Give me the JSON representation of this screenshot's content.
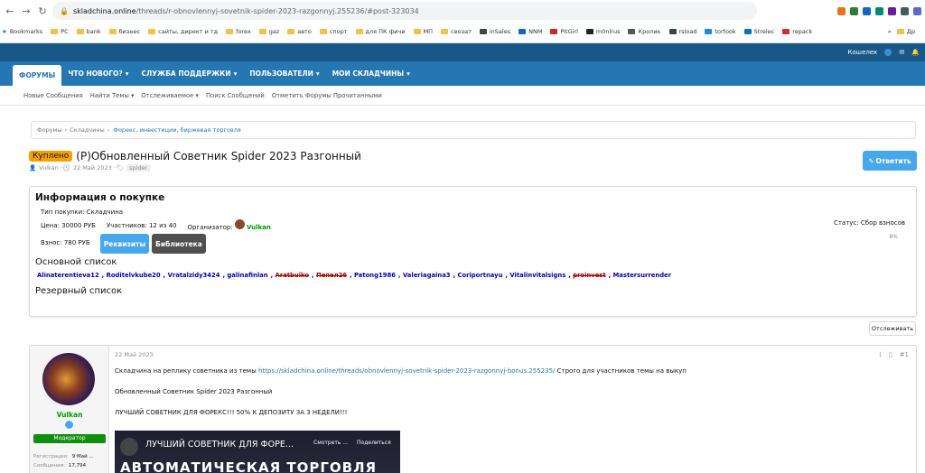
{
  "browser": {
    "url_host": "skladchina.online",
    "url_path": "/threads/r-obnovlennyj-sovetnik-spider-2023-razgonnyj.255236/#post-323034",
    "bookmarks_label": "Bookmarks",
    "bookmarks": [
      "PC",
      "bank",
      "бизнес",
      "сайты, директ и тд",
      "forex",
      "gaz",
      "авто",
      "спорт",
      "для ПК фичи",
      "МП",
      "сеозат",
      "inSales",
      "NNM",
      "PitGirl",
      "m0nlrus",
      "Кролик",
      "rsload",
      "torfook",
      "Strelec",
      "repack"
    ],
    "bookmarks_end": "Др"
  },
  "site": {
    "top_link": "Кошелек",
    "nav": [
      "ФОРУМЫ",
      "ЧТО НОВОГО?",
      "СЛУЖБА ПОДДЕРЖКИ",
      "ПОЛЬЗОВАТЕЛИ",
      "МОИ СКЛАДЧИНЫ"
    ],
    "subnav": [
      "Новые Сообщения",
      "Найти Темы",
      "Отслеживаемое",
      "Поиск Сообщений",
      "Отметить Форумы Прочитанными"
    ]
  },
  "breadcrumb": {
    "items": [
      "Форумы",
      "Складчины"
    ],
    "current": "Форекс, инвестиции, биржевая торговля"
  },
  "thread": {
    "badge": "Куплено",
    "title": "(Р)Обновленный Советник Spider 2023 Разгонный",
    "author": "Vulkan",
    "date": "22 Май 2023",
    "tag": "spider",
    "reply_label": "Ответить"
  },
  "purchase": {
    "heading": "Информация о покупке",
    "type": "Тип покупки: Складчина",
    "price": "Цена: 30000 РУБ",
    "participants": "Участников: 12 из 40",
    "organizer_label": "Организатор:",
    "organizer": "Vulkan",
    "status": "Статус: Сбор взносов",
    "progress": "8%",
    "fee": "Взнос: 780 РУБ",
    "btn_requisites": "Реквизиты",
    "btn_library": "Библиотека",
    "main_list_heading": "Основной список",
    "members": [
      "Alinaterentieva12",
      "Roditelvkube20",
      "Vratalzidy3424",
      "galinafinlan",
      "Aratbuiko",
      "Пепел26",
      "Patong1986",
      "Valeriagaina3",
      "Coriportnayu",
      "Vitalinvitalsigns",
      "proinvest",
      "Mastersurrender"
    ],
    "reserve_list_heading": "Резервный список"
  },
  "watch_label": "Отслеживать",
  "post": {
    "date": "22 Май 2023",
    "num": "#1",
    "username": "Vulkan",
    "rank": "Модератор",
    "reg_label": "Регистрация:",
    "reg_value": "9 Май ...",
    "msgs_label": "Сообщения:",
    "msgs_value": "17,794",
    "line1": "Складчина на реплику советника из темы",
    "line1_link": "https://skladchina.online/threads/obnovlennyj-sovetnik-spider-2023-razgonnyj-bonus.255235/",
    "line1_end": "Строго для участников темы на выкуп",
    "line2": "Обновленный Советник Spider 2023 Разгонный",
    "line3": "ЛУЧШИЙ СОВЕТНИК ДЛЯ ФОРЕКС!!! 50% К ДЕПОЗИТУ ЗА 3 НЕДЕЛИ!!!",
    "video_title": "ЛУЧШИЙ СОВЕТНИК ДЛЯ ФОРЕ...",
    "video_big": "АВТОМАТИЧЕСКАЯ ТОРГОВЛЯ",
    "video_watch": "Смотреть ...",
    "video_share": "Поделиться"
  }
}
